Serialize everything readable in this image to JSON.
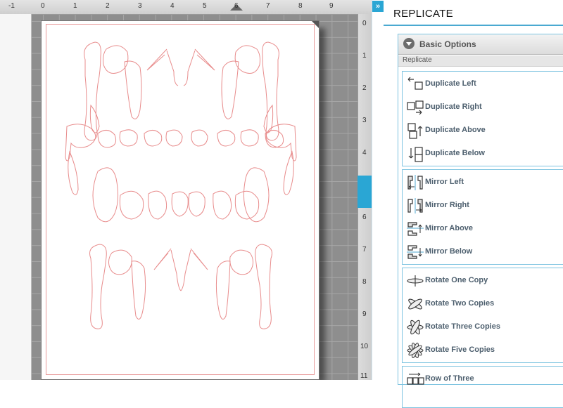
{
  "ruler": {
    "top_labels": [
      "-1",
      "0",
      "1",
      "2",
      "3",
      "4",
      "5",
      "6",
      "7",
      "8",
      "9"
    ],
    "right_labels": [
      "0",
      "1",
      "2",
      "3",
      "4",
      "5",
      "6",
      "7",
      "8",
      "9",
      "10",
      "11"
    ]
  },
  "panel": {
    "toggle_label": "»",
    "title": "REPLICATE",
    "section_label": "Basic Options",
    "sub_label": "Replicate",
    "groups": [
      {
        "items": [
          {
            "label": "Duplicate Left",
            "icon": "duplicate-left-icon"
          },
          {
            "label": "Duplicate Right",
            "icon": "duplicate-right-icon"
          },
          {
            "label": "Duplicate Above",
            "icon": "duplicate-above-icon"
          },
          {
            "label": "Duplicate Below",
            "icon": "duplicate-below-icon"
          }
        ]
      },
      {
        "items": [
          {
            "label": "Mirror Left",
            "icon": "mirror-left-icon"
          },
          {
            "label": "Mirror Right",
            "icon": "mirror-right-icon"
          },
          {
            "label": "Mirror Above",
            "icon": "mirror-above-icon"
          },
          {
            "label": "Mirror Below",
            "icon": "mirror-below-icon"
          }
        ]
      },
      {
        "items": [
          {
            "label": "Rotate One Copy",
            "icon": "rotate-one-icon"
          },
          {
            "label": "Rotate Two Copies",
            "icon": "rotate-two-icon"
          },
          {
            "label": "Rotate Three Copies",
            "icon": "rotate-three-icon"
          },
          {
            "label": "Rotate Five Copies",
            "icon": "rotate-five-icon"
          }
        ]
      },
      {
        "items": [
          {
            "label": "Row of Three",
            "icon": "row-of-three-icon"
          }
        ]
      }
    ]
  },
  "colors": {
    "accent": "#2aa6d4",
    "cut_line": "#e89a9a",
    "label": "#4d5f6e"
  }
}
